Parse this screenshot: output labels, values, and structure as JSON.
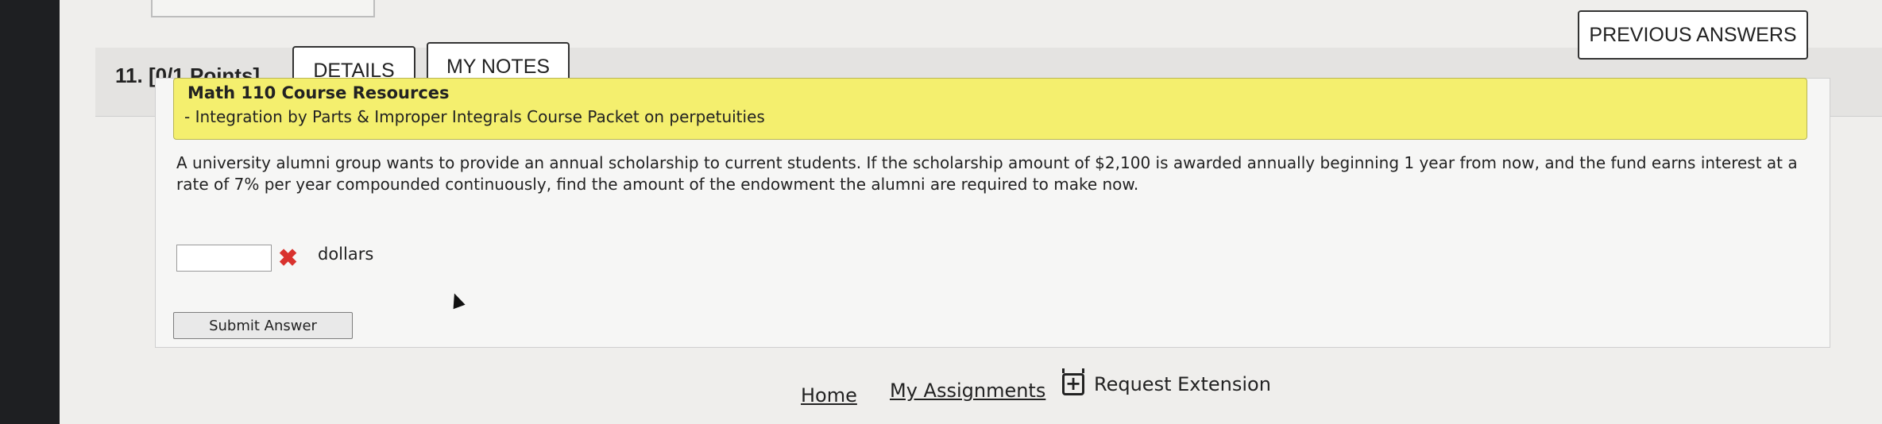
{
  "question": {
    "number_label": "11.",
    "points": "[0/1 Points]",
    "details_label": "DETAILS",
    "notes_label": "MY NOTES",
    "previous_answers_label": "PREVIOUS ANSWERS",
    "resource_title": "Math 110 Course Resources",
    "resource_link": "- Integration by Parts & Improper Integrals Course Packet on perpetuities",
    "text": "A university alumni group wants to provide an annual scholarship to current students. If the scholarship amount of $2,100 is awarded annually beginning 1 year from now, and the fund earns interest at a rate of 7% per year compounded continuously, find the amount of the endowment the alumni are required to make now.",
    "answer_value": "",
    "answer_unit": "dollars",
    "submit_label": "Submit Answer",
    "status_icon": "incorrect-x-icon",
    "status_color": "#d9322e"
  },
  "footer": {
    "home": "Home",
    "assignments": "My Assignments",
    "extension": "Request Extension",
    "extension_icon": "calendar-plus-icon"
  }
}
